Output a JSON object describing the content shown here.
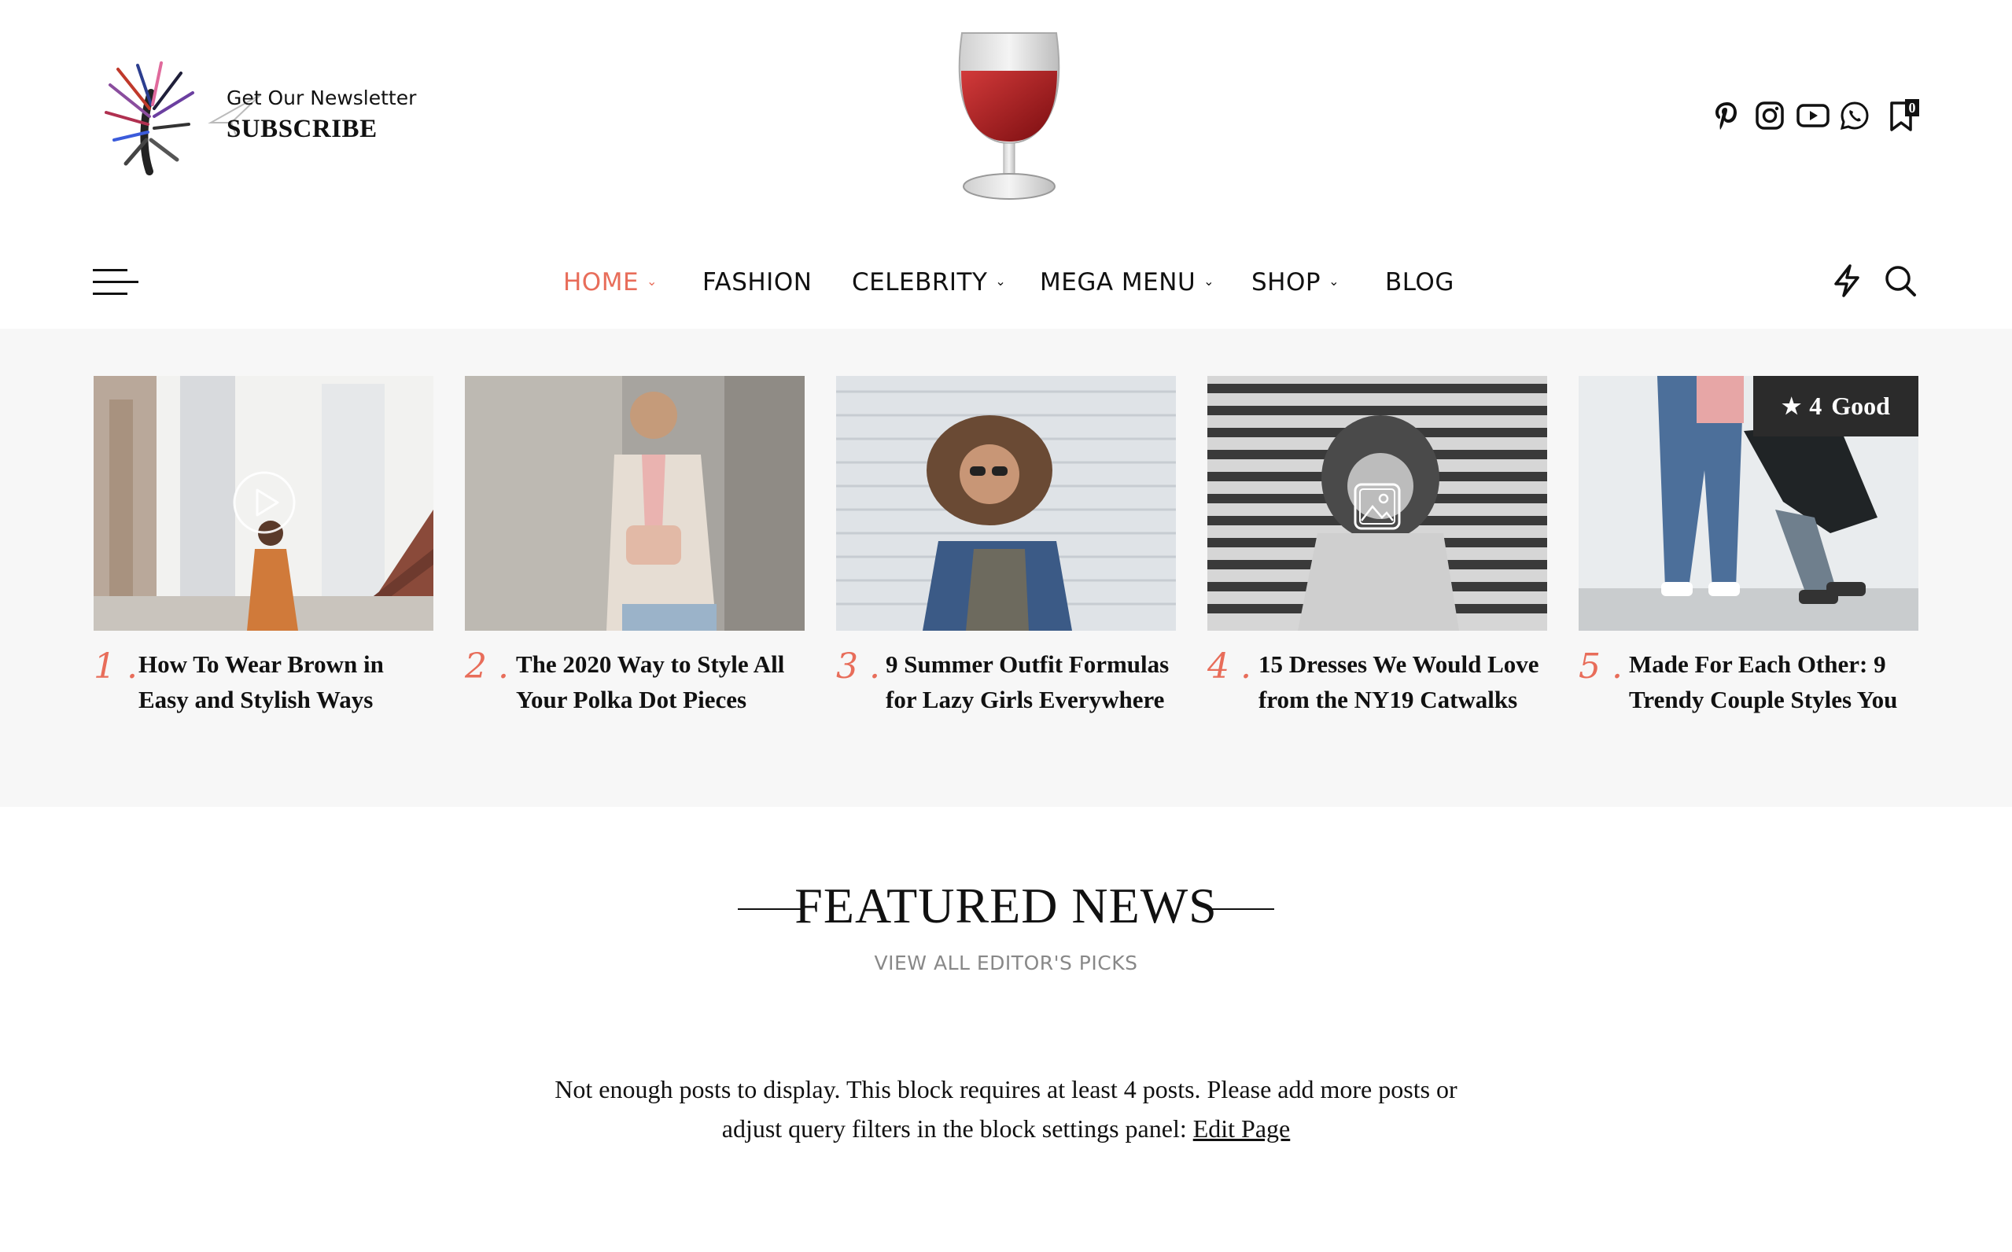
{
  "newsletter": {
    "small": "Get Our Newsletter",
    "big": "SUBSCRIBE"
  },
  "social": {
    "icons": [
      "pinterest-icon",
      "instagram-icon",
      "youtube-icon",
      "whatsapp-icon",
      "bookmark-icon"
    ],
    "bookmark_count": "0"
  },
  "nav": {
    "items": [
      {
        "label": "HOME",
        "dropdown": true,
        "active": true
      },
      {
        "label": "FASHION",
        "dropdown": false
      },
      {
        "label": "CELEBRITY",
        "dropdown": true
      },
      {
        "label": "MEGA MENU",
        "dropdown": true
      },
      {
        "label": "SHOP",
        "dropdown": true
      },
      {
        "label": "BLOG",
        "dropdown": false
      }
    ],
    "chevron": "⌄"
  },
  "colors": {
    "accent": "#e86d5a",
    "band": "#f7f7f7",
    "badge": "#2b2b2b"
  },
  "cards": [
    {
      "num": "1 .",
      "title": "How To Wear Brown in Easy and Stylish Ways",
      "overlay": "play-icon"
    },
    {
      "num": "2 .",
      "title": "The 2020 Way to Style All Your Polka Dot Pieces"
    },
    {
      "num": "3 .",
      "title": "9 Summer Outfit Formulas for Lazy Girls Everywhere"
    },
    {
      "num": "4 .",
      "title": "15 Dresses We Would Love from the NY19 Catwalks",
      "overlay": "gallery-icon"
    },
    {
      "num": "5 .",
      "title": "Made For Each Other: 9 Trendy Couple Styles You",
      "rating": {
        "star": "★",
        "value": "4",
        "label": "Good"
      }
    }
  ],
  "featured": {
    "title": "FEATURED NEWS",
    "subtitle": "VIEW ALL EDITOR'S PICKS",
    "notice": "Not enough posts to display. This block requires at least 4 posts. Please add more posts or adjust query filters in the block settings panel: ",
    "notice_link": "Edit Page"
  }
}
